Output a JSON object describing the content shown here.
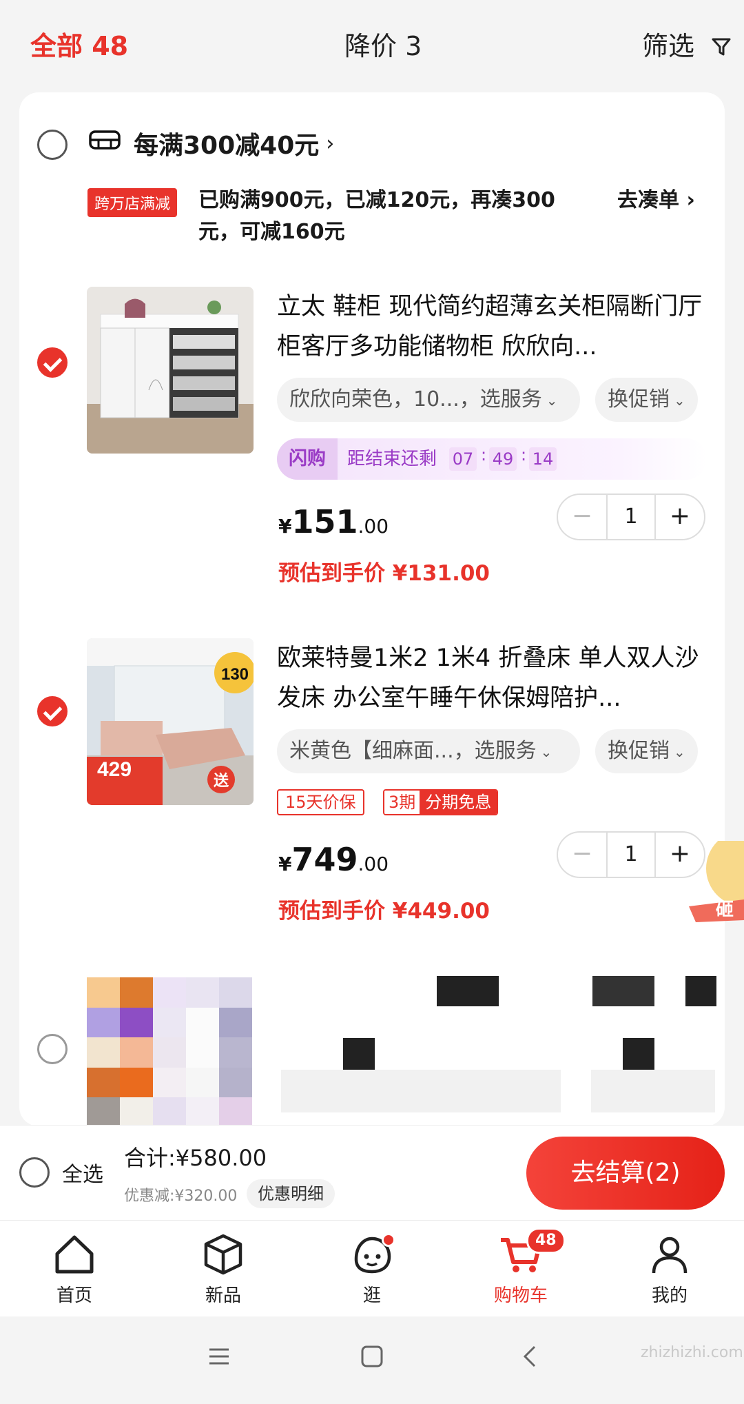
{
  "tabs": {
    "all": "全部 48",
    "price_drop": "降价 3",
    "filter": "筛选"
  },
  "promo": {
    "title": "每满300减40元",
    "badge": "跨万店满减",
    "desc": "已购满900元，已减120元，再凑300元，可减160元",
    "action": "去凑单 ›"
  },
  "items": [
    {
      "title": "立太 鞋柜 现代简约超薄玄关柜隔断门厅柜客厅多功能储物柜 欣欣向...",
      "spec": "欣欣向荣色，10...，选服务",
      "promo_chip": "换促销",
      "flash": {
        "tag": "闪购",
        "label": "距结束还剩",
        "hh": "07",
        "mm": "49",
        "ss": "14"
      },
      "price_int": "151",
      "price_dec": ".00",
      "qty": "1",
      "estimate": "预估到手价 ¥131.00",
      "checked": true
    },
    {
      "title": "欧莱特曼1米2 1米4 折叠床 单人双人沙发床 办公室午睡午休保姆陪护...",
      "spec": "米黄色【细麻面...，选服务",
      "promo_chip": "换促销",
      "tags": {
        "guarantee": "15天价保",
        "installment_a": "3期",
        "installment_b": "分期免息"
      },
      "price_int": "749",
      "price_dec": ".00",
      "qty": "1",
      "estimate": "预估到手价 ¥449.00",
      "checked": true,
      "image_text": {
        "badge_top": "130",
        "badge_bottom": "429",
        "send": "送"
      }
    }
  ],
  "currency": "¥",
  "side_coin_text": "砸",
  "totals": {
    "select_all": "全选",
    "sum": "合计:¥580.00",
    "discount": "优惠减:¥320.00",
    "detail": "优惠明细",
    "checkout": "去结算(2)"
  },
  "nav": [
    {
      "label": "首页",
      "icon": "home-icon"
    },
    {
      "label": "新品",
      "icon": "cube-icon"
    },
    {
      "label": "逛",
      "icon": "face-icon"
    },
    {
      "label": "购物车",
      "icon": "cart-icon",
      "badge": "48"
    },
    {
      "label": "我的",
      "icon": "user-icon"
    }
  ],
  "watermark": "zhizhizhi.com",
  "colors": {
    "accent": "#e8332b",
    "flash": "#9a3bc6"
  }
}
